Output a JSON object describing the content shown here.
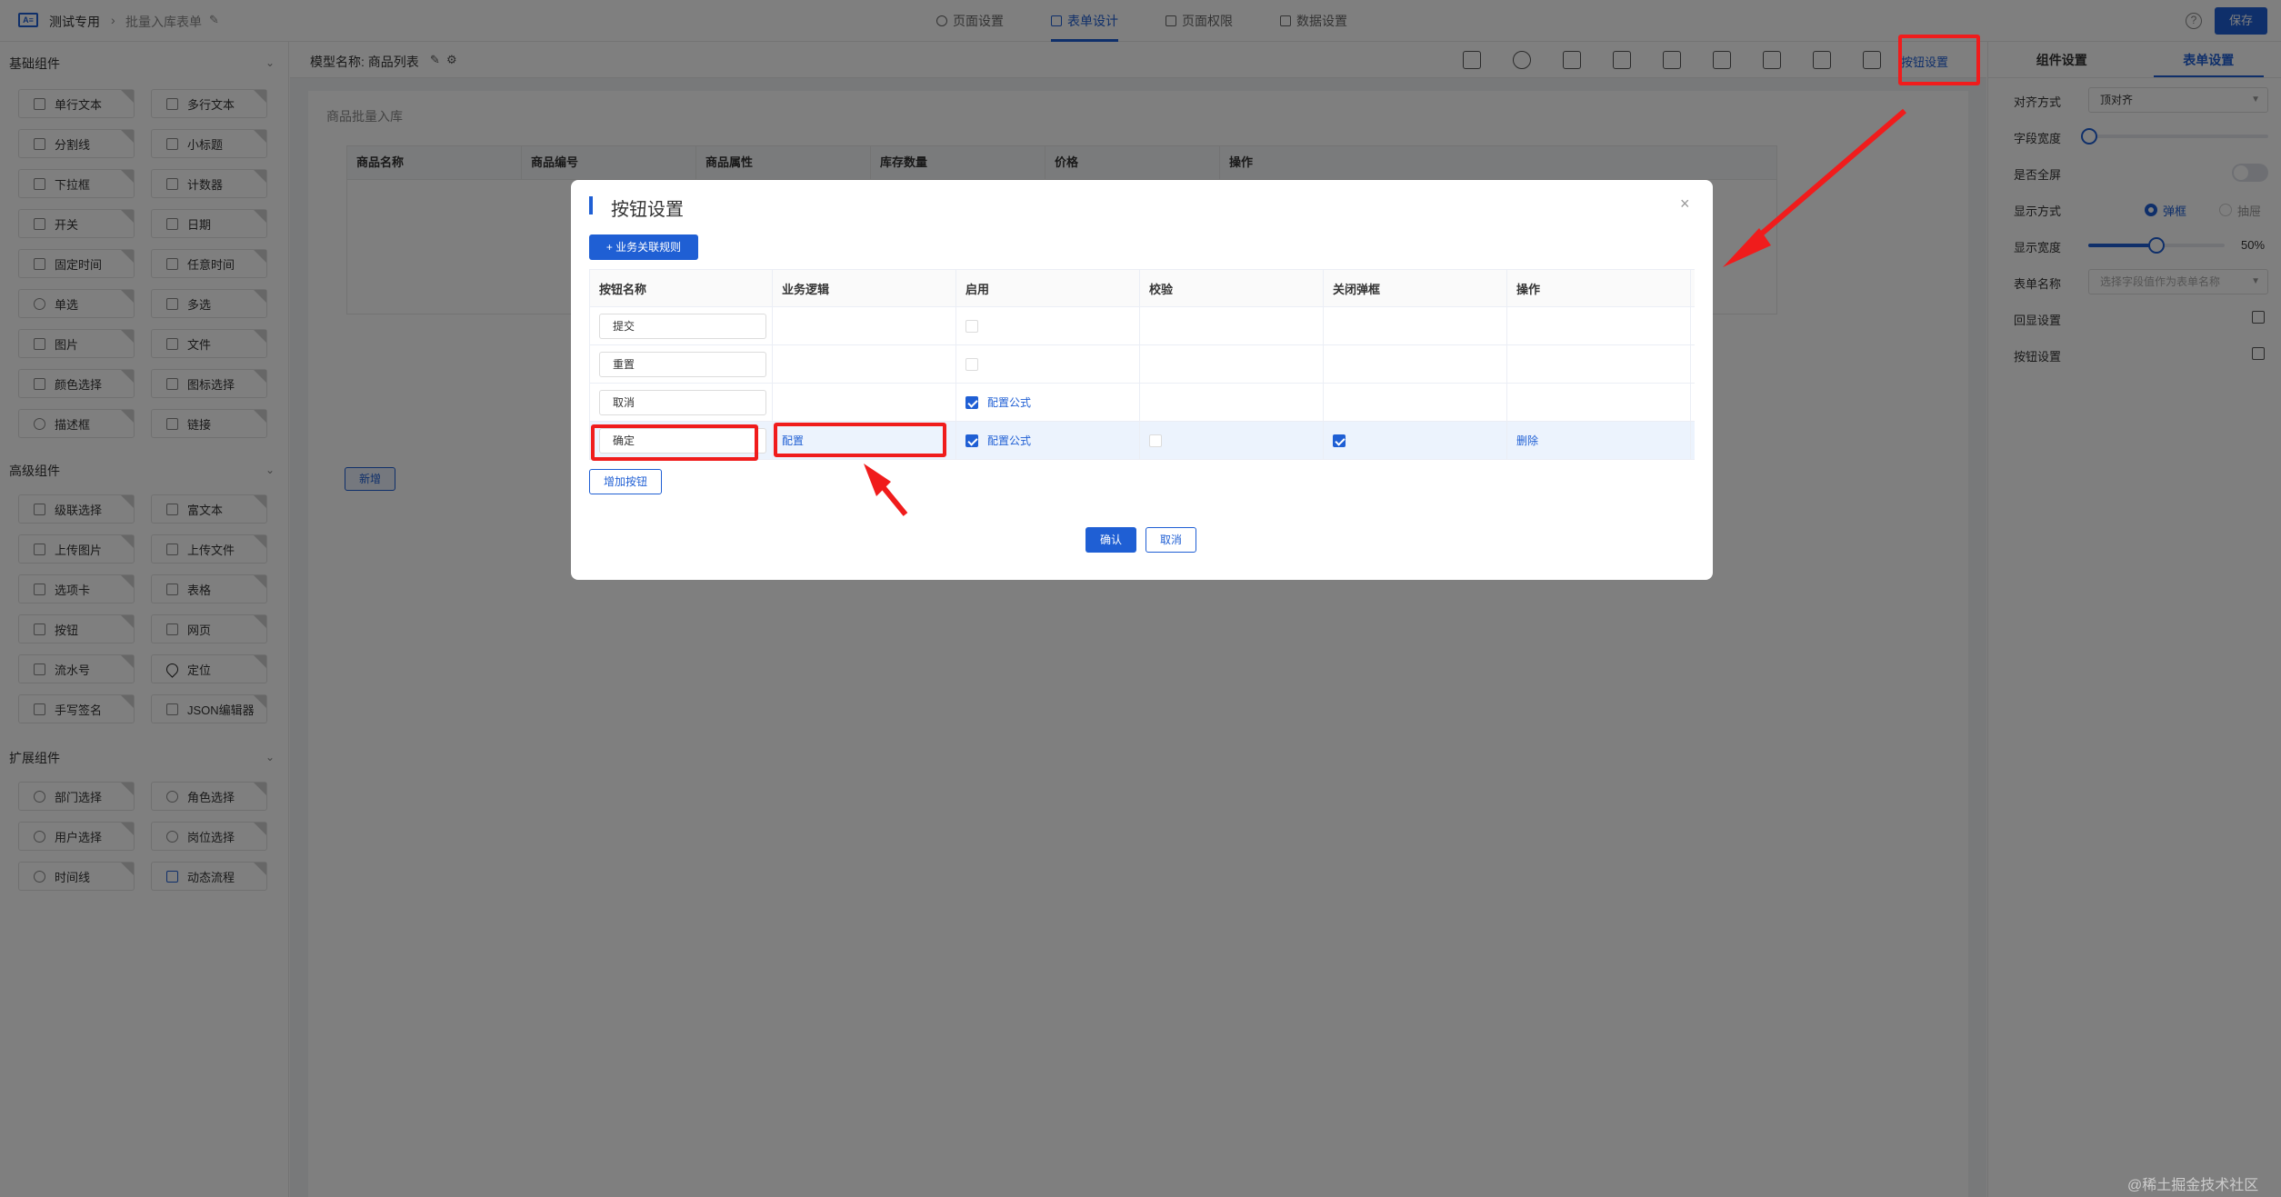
{
  "app": {
    "logo_text": "A≡",
    "project": "测试专用",
    "form_name": "批量入库表单"
  },
  "header": {
    "tabs": [
      {
        "label": "页面设置"
      },
      {
        "label": "表单设计"
      },
      {
        "label": "页面权限"
      },
      {
        "label": "数据设置"
      }
    ],
    "active_tab": "表单设计",
    "save_label": "保存",
    "help_icon": "?"
  },
  "sidebar": {
    "groups": [
      {
        "title": "基础组件",
        "items": [
          "单行文本",
          "多行文本",
          "分割线",
          "小标题",
          "下拉框",
          "计数器",
          "开关",
          "日期",
          "固定时间",
          "任意时间",
          "单选",
          "多选",
          "图片",
          "文件",
          "颜色选择",
          "图标选择",
          "描述框",
          "链接"
        ]
      },
      {
        "title": "高级组件",
        "items": [
          "级联选择",
          "富文本",
          "上传图片",
          "上传文件",
          "选项卡",
          "表格",
          "按钮",
          "网页",
          "流水号",
          "定位",
          "手写签名",
          "JSON编辑器"
        ]
      },
      {
        "title": "扩展组件",
        "items": [
          "部门选择",
          "角色选择",
          "用户选择",
          "岗位选择",
          "时间线",
          "动态流程"
        ]
      }
    ]
  },
  "canvas": {
    "model_label": "模型名称: 商品列表",
    "button_settings_label": "按钮设置",
    "form_title": "商品批量入库",
    "columns": [
      "商品名称",
      "商品编号",
      "商品属性",
      "库存数量",
      "价格",
      "操作"
    ],
    "new_label": "新增"
  },
  "right_panel": {
    "tabs": [
      "组件设置",
      "表单设置"
    ],
    "active_tab": "表单设置",
    "align_label": "对齐方式",
    "align_value": "顶对齐",
    "field_width_label": "字段宽度",
    "field_width_value": 0,
    "fullscreen_label": "是否全屏",
    "display_mode_label": "显示方式",
    "display_options": [
      "弹框",
      "抽屉"
    ],
    "display_selected": "弹框",
    "display_width_label": "显示宽度",
    "display_width_value": "50%",
    "display_width_fraction": 0.5,
    "form_name_label": "表单名称",
    "form_name_placeholder": "选择字段值作为表单名称",
    "echo_label": "回显设置",
    "button_label": "按钮设置"
  },
  "dialog": {
    "title": "按钮设置",
    "close_icon": "×",
    "biz_rule_label": "+ 业务关联规则",
    "columns": [
      "按钮名称",
      "业务逻辑",
      "启用",
      "校验",
      "关闭弹框",
      "操作"
    ],
    "rows": [
      {
        "name": "提交",
        "logic": "",
        "enabled": false,
        "formula": "",
        "verify": null,
        "close": null,
        "action": ""
      },
      {
        "name": "重置",
        "logic": "",
        "enabled": false,
        "formula": "",
        "verify": null,
        "close": null,
        "action": ""
      },
      {
        "name": "取消",
        "logic": "",
        "enabled": true,
        "formula": "配置公式",
        "verify": null,
        "close": null,
        "action": ""
      },
      {
        "name": "确定",
        "logic": "配置",
        "enabled": true,
        "formula": "配置公式",
        "verify": false,
        "close": true,
        "action": "删除"
      }
    ],
    "add_label": "增加按钮",
    "ok_label": "确认",
    "cancel_label": "取消"
  },
  "watermark": "@稀土掘金技术社区",
  "colors": {
    "accent": "#1f5fd4",
    "annotation": "#f01c1c"
  }
}
